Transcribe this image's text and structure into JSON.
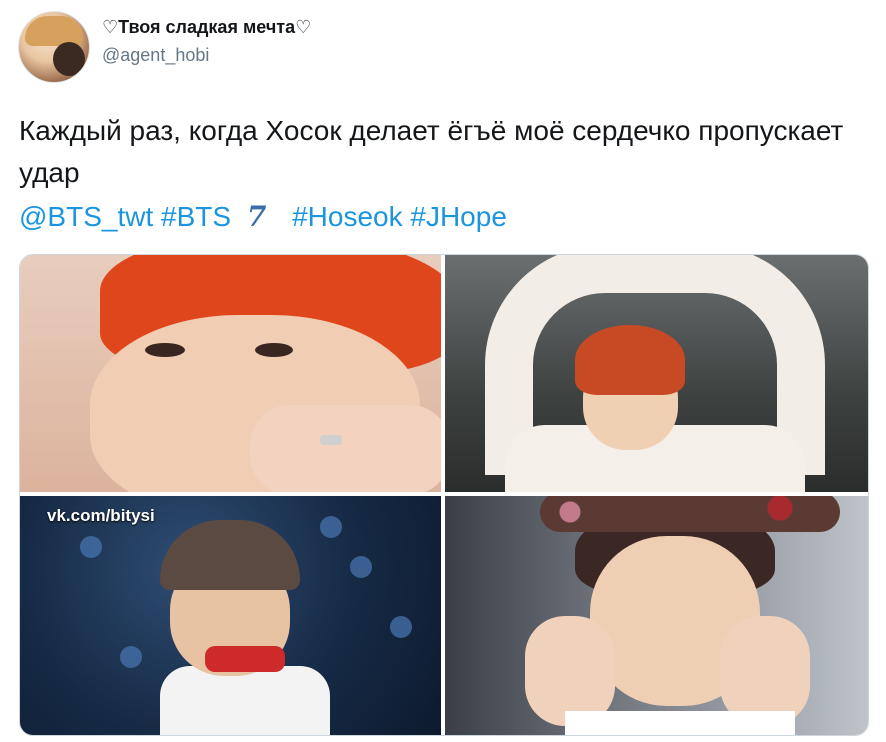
{
  "tweet": {
    "display_name": "♡Твоя сладкая мечта♡",
    "handle": "@agent_hobi",
    "text": "Каждый раз, когда Хосок делает ёгъё моё сердечко пропускает удар",
    "tags": {
      "mention": "@BTS_twt",
      "tag1": "#BTS",
      "seven": "7",
      "tag2": "#Hoseok",
      "tag3": "#JHope"
    }
  },
  "media": {
    "watermark": "vk.com/bitysi",
    "photos": [
      "photo-1",
      "photo-2",
      "photo-3",
      "photo-4"
    ]
  },
  "colors": {
    "link": "#1b95e0",
    "text": "#14171a",
    "secondary": "#657786",
    "border": "#ccd6dd"
  }
}
